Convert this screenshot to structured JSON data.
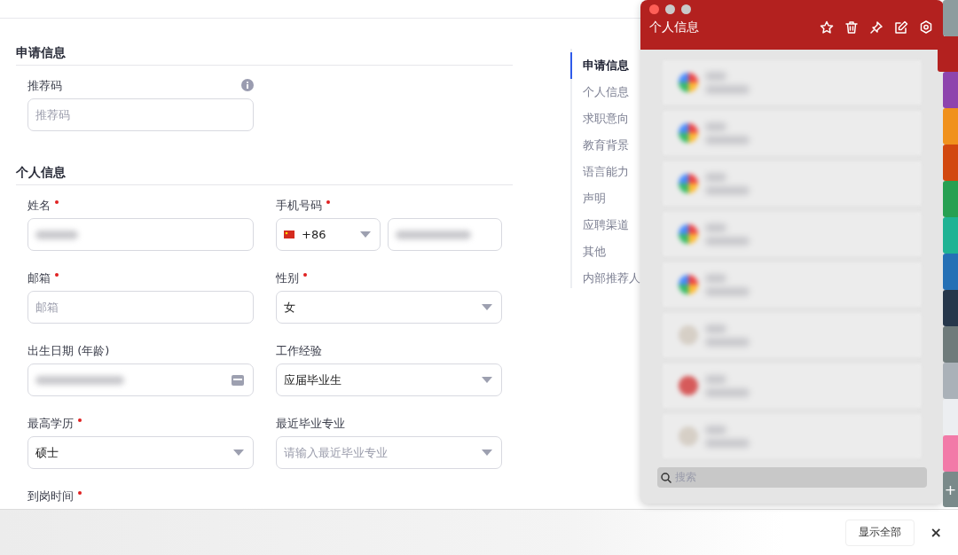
{
  "form": {
    "sections": [
      {
        "title": "申请信息",
        "fields": [
          {
            "kind": "text",
            "label": "推荐码",
            "required": false,
            "info": true,
            "placeholder": "推荐码"
          }
        ]
      },
      {
        "title": "个人信息",
        "fields": [
          {
            "kind": "text",
            "label": "姓名",
            "required": true,
            "blurred": true
          },
          {
            "kind": "phone",
            "label": "手机号码",
            "required": true,
            "code": "+86",
            "blurred": true
          },
          {
            "kind": "text",
            "label": "邮箱",
            "required": true,
            "placeholder": "邮箱"
          },
          {
            "kind": "select",
            "label": "性别",
            "required": true,
            "value": "女"
          },
          {
            "kind": "date",
            "label": "出生日期 (年龄)",
            "required": false,
            "blurred": true
          },
          {
            "kind": "select",
            "label": "工作经验",
            "required": false,
            "value": "应届毕业生"
          },
          {
            "kind": "select",
            "label": "最高学历",
            "required": true,
            "value": "硕士"
          },
          {
            "kind": "select",
            "label": "最近毕业专业",
            "required": false,
            "placeholder": "请输入最近毕业专业"
          },
          {
            "kind": "label",
            "label": "到岗时间",
            "required": true
          }
        ]
      }
    ]
  },
  "nav": [
    {
      "label": "申请信息",
      "selected": true
    },
    {
      "label": "个人信息",
      "selected": false
    },
    {
      "label": "求职意向",
      "selected": false
    },
    {
      "label": "教育背景",
      "selected": false
    },
    {
      "label": "语言能力",
      "selected": false
    },
    {
      "label": "声明",
      "selected": false
    },
    {
      "label": "应聘渠道",
      "selected": false
    },
    {
      "label": "其他",
      "selected": false
    },
    {
      "label": "内部推荐人",
      "selected": false
    }
  ],
  "clipboard": {
    "title": "个人信息",
    "items": [
      {
        "kind": "colorful"
      },
      {
        "kind": "colorful"
      },
      {
        "kind": "colorful"
      },
      {
        "kind": "colorful"
      },
      {
        "kind": "colorful"
      },
      {
        "kind": "plain"
      },
      {
        "kind": "red"
      },
      {
        "kind": "plain"
      }
    ],
    "search": {
      "placeholder": "搜索"
    },
    "tabs": [
      {
        "kind": "color",
        "color": "#8d9c9e",
        "selected": false
      },
      {
        "kind": "color",
        "color": "#b3211f",
        "selected": true
      },
      {
        "kind": "color",
        "color": "#8e44ad",
        "selected": false
      },
      {
        "kind": "color",
        "color": "#f0911c",
        "selected": false
      },
      {
        "kind": "color",
        "color": "#d2480f",
        "selected": false
      },
      {
        "kind": "color",
        "color": "#27a052",
        "selected": false
      },
      {
        "kind": "color",
        "color": "#1fb394",
        "selected": false
      },
      {
        "kind": "color",
        "color": "#2570b5",
        "selected": false
      },
      {
        "kind": "color",
        "color": "#26374b",
        "selected": false
      },
      {
        "kind": "color",
        "color": "#6f7b7b",
        "selected": false
      },
      {
        "kind": "color",
        "color": "#aab1b8",
        "selected": false
      },
      {
        "kind": "color",
        "color": "#eceef1",
        "selected": false
      },
      {
        "kind": "color",
        "color": "#f27aa8",
        "selected": false
      },
      {
        "kind": "add",
        "label": "+"
      }
    ]
  },
  "bottom_bar": {
    "button": "显示全部",
    "close": "×"
  }
}
